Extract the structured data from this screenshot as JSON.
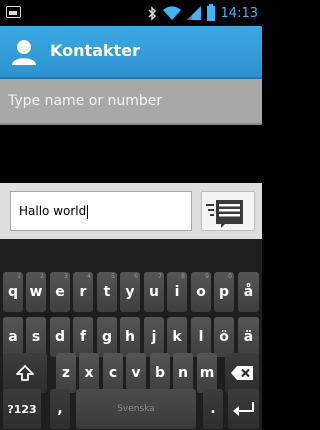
{
  "statusbar": {
    "time": "14:13",
    "icons": [
      "screenshot-icon",
      "bluetooth-icon",
      "wifi-icon",
      "signal-icon",
      "battery-icon"
    ]
  },
  "actionbar": {
    "title": "Kontakter",
    "icon": "person-icon",
    "color": "#33a0dc"
  },
  "recipient": {
    "placeholder": "Type name or number"
  },
  "compose": {
    "text": "Hallo world",
    "send_icon": "send-message-icon"
  },
  "keyboard": {
    "row1": [
      {
        "label": "q",
        "sub": "1"
      },
      {
        "label": "w",
        "sub": "2"
      },
      {
        "label": "e",
        "sub": "3"
      },
      {
        "label": "r",
        "sub": "4"
      },
      {
        "label": "t",
        "sub": "5"
      },
      {
        "label": "y",
        "sub": "6"
      },
      {
        "label": "u",
        "sub": "7"
      },
      {
        "label": "i",
        "sub": "8"
      },
      {
        "label": "o",
        "sub": "9"
      },
      {
        "label": "p",
        "sub": "0"
      },
      {
        "label": "å",
        "sub": ""
      }
    ],
    "row2": [
      "a",
      "s",
      "d",
      "f",
      "g",
      "h",
      "j",
      "k",
      "l",
      "ö",
      "ä"
    ],
    "row3": [
      "z",
      "x",
      "c",
      "v",
      "b",
      "n",
      "m"
    ],
    "symbols_label": "?123",
    "comma_label": ",",
    "space_label": "Svenska",
    "period_label": "."
  }
}
